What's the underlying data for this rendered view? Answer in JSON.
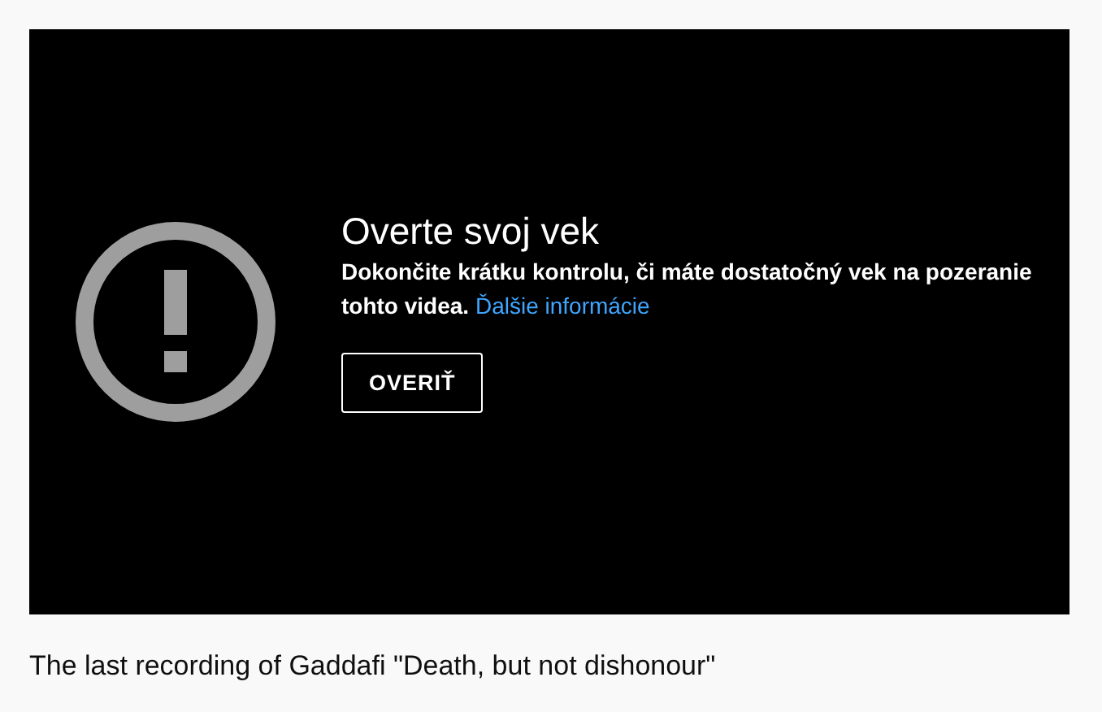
{
  "player": {
    "title": "Overte svoj vek",
    "message": "Dokončite krátku kontrolu, či máte dostatočný vek na pozeranie tohto videa.",
    "link": "Ďalšie informácie",
    "button": "OVERIŤ"
  },
  "video_title": "The last recording of Gaddafi \"Death, but not dishonour\""
}
